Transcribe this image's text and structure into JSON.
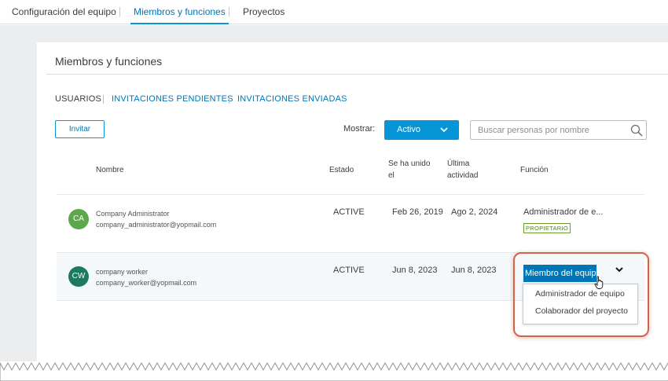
{
  "topnav": {
    "tabs": [
      {
        "label": "Configuración del equipo",
        "active": false
      },
      {
        "label": "Miembros y funciones",
        "active": true
      },
      {
        "label": "Proyectos",
        "active": false
      }
    ]
  },
  "panel": {
    "title": "Miembros y funciones",
    "subtabs": [
      {
        "label": "USUARIOS",
        "active": true
      },
      {
        "label": "INVITACIONES PENDIENTES",
        "active": false
      },
      {
        "label": "INVITACIONES ENVIADAS",
        "active": false
      }
    ],
    "invite_label": "Invitar",
    "show_label": "Mostrar:",
    "status_filter": "Activo",
    "search_placeholder": "Buscar personas por nombre"
  },
  "table": {
    "headers": {
      "name": "Nombre",
      "status": "Estado",
      "joined_line1": "Se ha unido",
      "joined_line2": "el",
      "activity_line1": "Última",
      "activity_line2": "actividad",
      "role": "Función"
    },
    "rows": [
      {
        "initials": "CA",
        "avatar_color": "#5aa84a",
        "name": "Company Administrator",
        "email": "company_administrator@yopmail.com",
        "status": "ACTIVE",
        "joined": "Feb 26, 2019",
        "last_activity": "Ago 2, 2024",
        "role": "Administrador de e...",
        "badge": "PROPIETARIO"
      },
      {
        "initials": "CW",
        "avatar_color": "#1e7a5c",
        "name": "company worker",
        "email": "company_worker@yopmail.com",
        "status": "ACTIVE",
        "joined": "Jun 8, 2023",
        "last_activity": "Jun 8, 2023",
        "role": "Miembro del equipo"
      }
    ]
  },
  "role_menu": {
    "options": [
      "Administrador de equipo",
      "Colaborador del proyecto"
    ]
  },
  "colors": {
    "accent": "#0696d7",
    "accent_dark": "#0076b6",
    "highlight": "#d0654a"
  }
}
